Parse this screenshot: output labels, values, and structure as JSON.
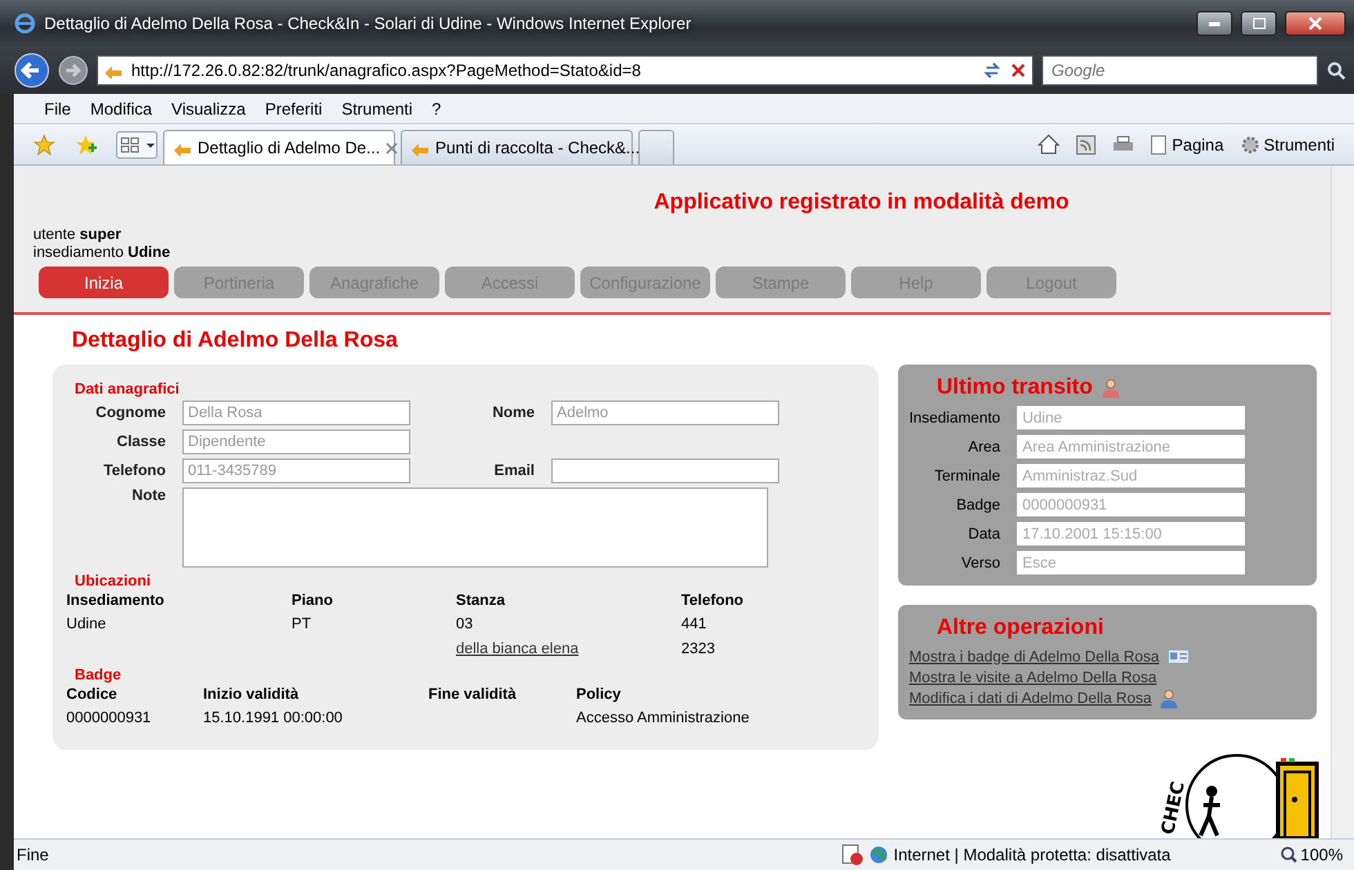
{
  "window": {
    "title": "Dettaglio di Adelmo Della Rosa - Check&In - Solari di Udine - Windows Internet Explorer"
  },
  "address_bar": {
    "url": "http://172.26.0.82:82/trunk/anagrafico.aspx?PageMethod=Stato&id=8"
  },
  "search": {
    "placeholder": "Google"
  },
  "menu": [
    "File",
    "Modifica",
    "Visualizza",
    "Preferiti",
    "Strumenti",
    "?"
  ],
  "browser_tabs": [
    {
      "label": "Dettaglio di Adelmo De...",
      "selected": true
    },
    {
      "label": "Punti di raccolta - Check&...",
      "selected": false
    }
  ],
  "command_bar": [
    "Pagina",
    "Strumenti"
  ],
  "page": {
    "demo_notice": "Applicativo registrato in modalità demo",
    "user_line": "utente **super**",
    "site_line": "insediamento **Udine**",
    "nav": [
      {
        "label": "Inizia",
        "selected": true
      },
      {
        "label": "Portineria",
        "selected": false
      },
      {
        "label": "Anagrafiche",
        "selected": false
      },
      {
        "label": "Accessi",
        "selected": false
      },
      {
        "label": "Configurazione",
        "selected": false
      },
      {
        "label": "Stampe",
        "selected": false
      },
      {
        "label": "Help",
        "selected": false
      },
      {
        "label": "Logout",
        "selected": false
      }
    ],
    "heading": "Dettaglio di Adelmo Della Rosa",
    "personal": {
      "title": "Dati anagrafici",
      "fields": [
        {
          "label": "Cognome",
          "value": "Della Rosa"
        },
        {
          "label": "Nome",
          "value": "Adelmo"
        },
        {
          "label": "Classe",
          "value": "Dipendente"
        },
        {
          "label": "Telefono",
          "value": "011-3435789"
        },
        {
          "label": "Email"
        },
        {
          "label": "Note"
        }
      ]
    },
    "locations": {
      "title": "Ubicazioni",
      "columns": [
        "Insediamento",
        "Piano",
        "Stanza",
        "Telefono"
      ],
      "rows": [
        [
          "Udine",
          "PT",
          "03",
          "441"
        ],
        [
          "",
          "",
          "della bianca elena",
          "2323"
        ]
      ]
    },
    "badges": {
      "title": "Badge",
      "columns": [
        "Codice",
        "Inizio validità",
        "Fine validità",
        "Policy"
      ],
      "rows": [
        [
          "0000000931",
          "15.10.1991 00:00:00",
          "",
          "Accesso Amministrazione"
        ]
      ]
    },
    "last_transit": {
      "title": "Ultimo transito",
      "fields": [
        {
          "label": "Insediamento",
          "value": "Udine"
        },
        {
          "label": "Area",
          "value": "Area Amministrazione"
        },
        {
          "label": "Terminale",
          "value": "Amministraz.Sud"
        },
        {
          "label": "Badge",
          "value": "0000000931"
        },
        {
          "label": "Data",
          "value": "17.10.2001 15:15:00"
        },
        {
          "label": "Verso",
          "value": "Esce"
        }
      ]
    },
    "other_operations": {
      "title": "Altre operazioni",
      "links": [
        {
          "label": "Mostra i badge di Adelmo Della Rosa",
          "kind": "badge"
        },
        {
          "label": "Mostra le visite a Adelmo Della Rosa",
          "kind": "none"
        },
        {
          "label": "Modifica i dati di Adelmo Della Rosa",
          "kind": "person"
        }
      ]
    },
    "logo_text": "CHEC"
  },
  "status_bar": {
    "text": "Fine",
    "zone": "Internet | Modalità protetta: disattivata",
    "zoom": "100%"
  }
}
